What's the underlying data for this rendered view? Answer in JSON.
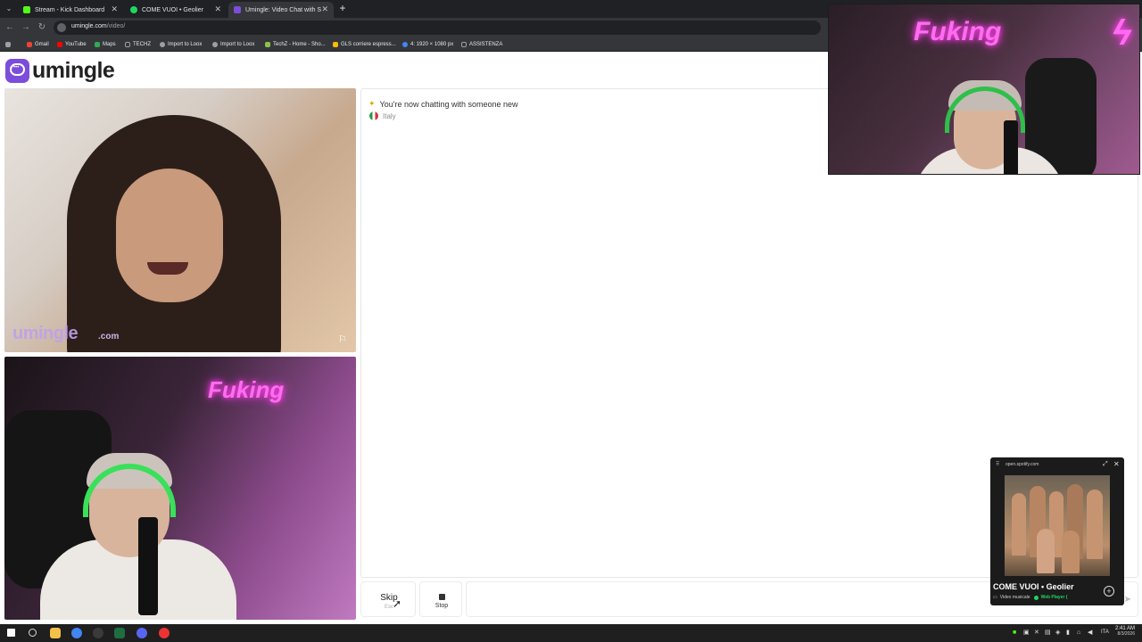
{
  "browser": {
    "tabs": [
      {
        "title": "Stream - Kick Dashboard",
        "color": "#53fc18"
      },
      {
        "title": "COME VUOI • Geolier",
        "color": "#1ed760"
      },
      {
        "title": "Umingle: Video Chat with S",
        "color": "#7c4ddb",
        "active": true
      }
    ],
    "new_tab": "+",
    "url_host": "umingle.com",
    "url_path": "/video/",
    "bookmarks": [
      {
        "label": "Gmail",
        "color": "#ea4335"
      },
      {
        "label": "YouTube",
        "color": "#ff0000"
      },
      {
        "label": "Maps",
        "color": "#34a853"
      },
      {
        "label": "TECHZ",
        "color": "#9aa0a6"
      },
      {
        "label": "Import to Loox",
        "color": "#9aa0a6"
      },
      {
        "label": "Import to Loox",
        "color": "#9aa0a6"
      },
      {
        "label": "TechZ - Home - Sho...",
        "color": "#8bc34a"
      },
      {
        "label": "GLS corriere espress...",
        "color": "#fbbc04"
      },
      {
        "label": "4: 1920 × 1080 px",
        "color": "#4285f4"
      },
      {
        "label": "ASSISTENZA",
        "color": "#9aa0a6"
      }
    ]
  },
  "site": {
    "logo_text": "umingle",
    "watermark": "umingle",
    "watermark_suffix": ".com"
  },
  "chat": {
    "status": "You're now chatting with someone new",
    "country": "Italy"
  },
  "controls": {
    "skip_label": "Skip",
    "skip_key": "Esc",
    "stop_label": "Stop",
    "message_placeholder": ""
  },
  "overlay": {
    "neon_text": "Fuking"
  },
  "self_cam": {
    "neon_text": "Fuking"
  },
  "mini_player": {
    "host": "open.spotify.com",
    "title": "COME VUOI • Geolier",
    "kind": "Video musicale",
    "source": "Web Player (",
    "accent": "#1ed760"
  },
  "taskbar": {
    "lang": "ITA",
    "time": "2:41 AM",
    "date": "8/3/2026"
  },
  "colors": {
    "brand": "#7c4ddb",
    "chrome_dark": "#202124",
    "chrome_mid": "#35363a"
  }
}
